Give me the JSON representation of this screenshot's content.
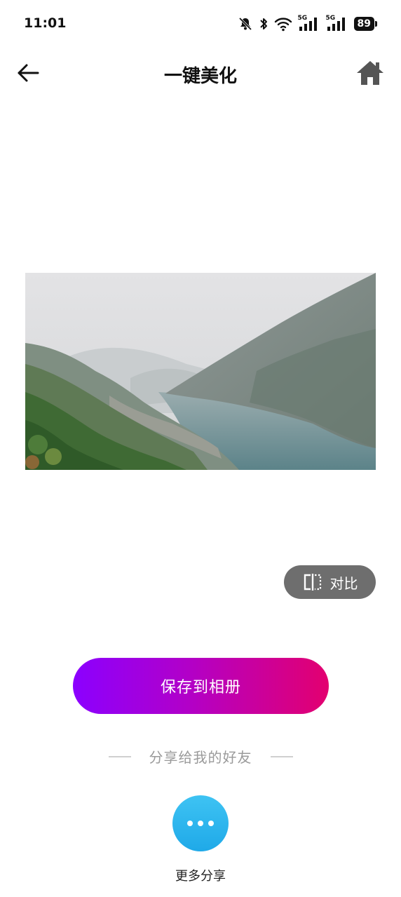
{
  "status_bar": {
    "time": "11:01",
    "network_label_1": "5G",
    "network_label_2": "5G",
    "battery": "89"
  },
  "header": {
    "title": "一键美化",
    "back_icon": "arrow-left-icon",
    "home_icon": "home-icon"
  },
  "photo": {
    "description_icon": "landscape-photo"
  },
  "compare": {
    "label": "对比",
    "icon": "compare-icon"
  },
  "save": {
    "label": "保存到相册"
  },
  "share": {
    "heading": "分享给我的好友",
    "more_label": "更多分享",
    "more_icon": "more-icon"
  },
  "colors": {
    "save_gradient_start": "#8b00ff",
    "save_gradient_end": "#e3006f",
    "share_button": "#2db5ee",
    "compare_bg": "#6e6e6e"
  }
}
